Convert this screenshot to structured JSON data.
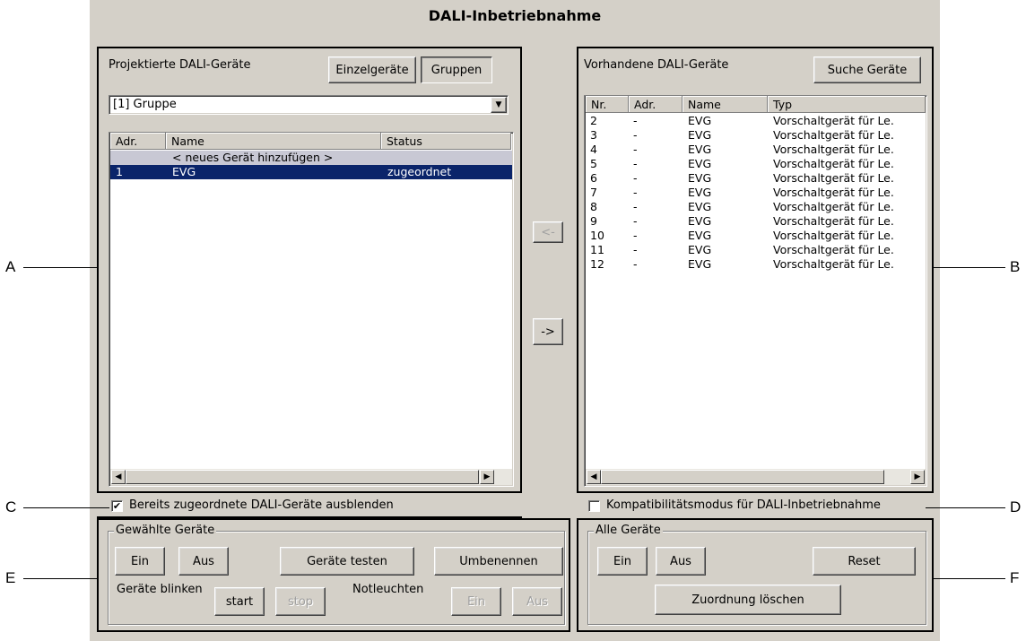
{
  "window_title": "DALI-Inbetriebnahme",
  "callouts": [
    "A",
    "B",
    "C",
    "D",
    "E",
    "F"
  ],
  "left_panel": {
    "label": "Projektierte DALI-Geräte",
    "tab_einzel": "Einzelgeräte",
    "tab_gruppen": "Gruppen",
    "dropdown_value": "[1] Gruppe",
    "columns": [
      "Adr.",
      "Name",
      "Status"
    ],
    "rows": [
      {
        "adr": "",
        "name": "< neues Gerät hinzufügen >",
        "status": ""
      },
      {
        "adr": "1",
        "name": "EVG",
        "status": "zugeordnet"
      }
    ]
  },
  "right_panel": {
    "label": "Vorhandene DALI-Geräte",
    "search_button": "Suche Geräte",
    "columns": [
      "Nr.",
      "Adr.",
      "Name",
      "Typ"
    ],
    "rows": [
      {
        "nr": "2",
        "adr": "-",
        "name": "EVG",
        "typ": "Vorschaltgerät für Le."
      },
      {
        "nr": "3",
        "adr": "-",
        "name": "EVG",
        "typ": "Vorschaltgerät für Le."
      },
      {
        "nr": "4",
        "adr": "-",
        "name": "EVG",
        "typ": "Vorschaltgerät für Le."
      },
      {
        "nr": "5",
        "adr": "-",
        "name": "EVG",
        "typ": "Vorschaltgerät für Le."
      },
      {
        "nr": "6",
        "adr": "-",
        "name": "EVG",
        "typ": "Vorschaltgerät für Le."
      },
      {
        "nr": "7",
        "adr": "-",
        "name": "EVG",
        "typ": "Vorschaltgerät für Le."
      },
      {
        "nr": "8",
        "adr": "-",
        "name": "EVG",
        "typ": "Vorschaltgerät für Le."
      },
      {
        "nr": "9",
        "adr": "-",
        "name": "EVG",
        "typ": "Vorschaltgerät für Le."
      },
      {
        "nr": "10",
        "adr": "-",
        "name": "EVG",
        "typ": "Vorschaltgerät für Le."
      },
      {
        "nr": "11",
        "adr": "-",
        "name": "EVG",
        "typ": "Vorschaltgerät für Le."
      },
      {
        "nr": "12",
        "adr": "-",
        "name": "EVG",
        "typ": "Vorschaltgerät für Le."
      }
    ]
  },
  "move_left": "<-",
  "move_right": "->",
  "hide_assigned": {
    "label": "Bereits zugeordnete DALI-Geräte ausblenden",
    "checked": true
  },
  "compat_mode": {
    "label": "Kompatibilitätsmodus für DALI-Inbetriebnahme",
    "checked": false
  },
  "selected_devices": {
    "legend": "Gewählte Geräte",
    "ein": "Ein",
    "aus": "Aus",
    "test": "Geräte testen",
    "rename": "Umbenennen",
    "blink_label": "Geräte blinken",
    "start": "start",
    "stop": "stop",
    "emergency_label": "Notleuchten",
    "em_ein": "Ein",
    "em_aus": "Aus"
  },
  "all_devices": {
    "legend": "Alle Geräte",
    "ein": "Ein",
    "aus": "Aus",
    "reset": "Reset",
    "clear": "Zuordnung löschen"
  }
}
